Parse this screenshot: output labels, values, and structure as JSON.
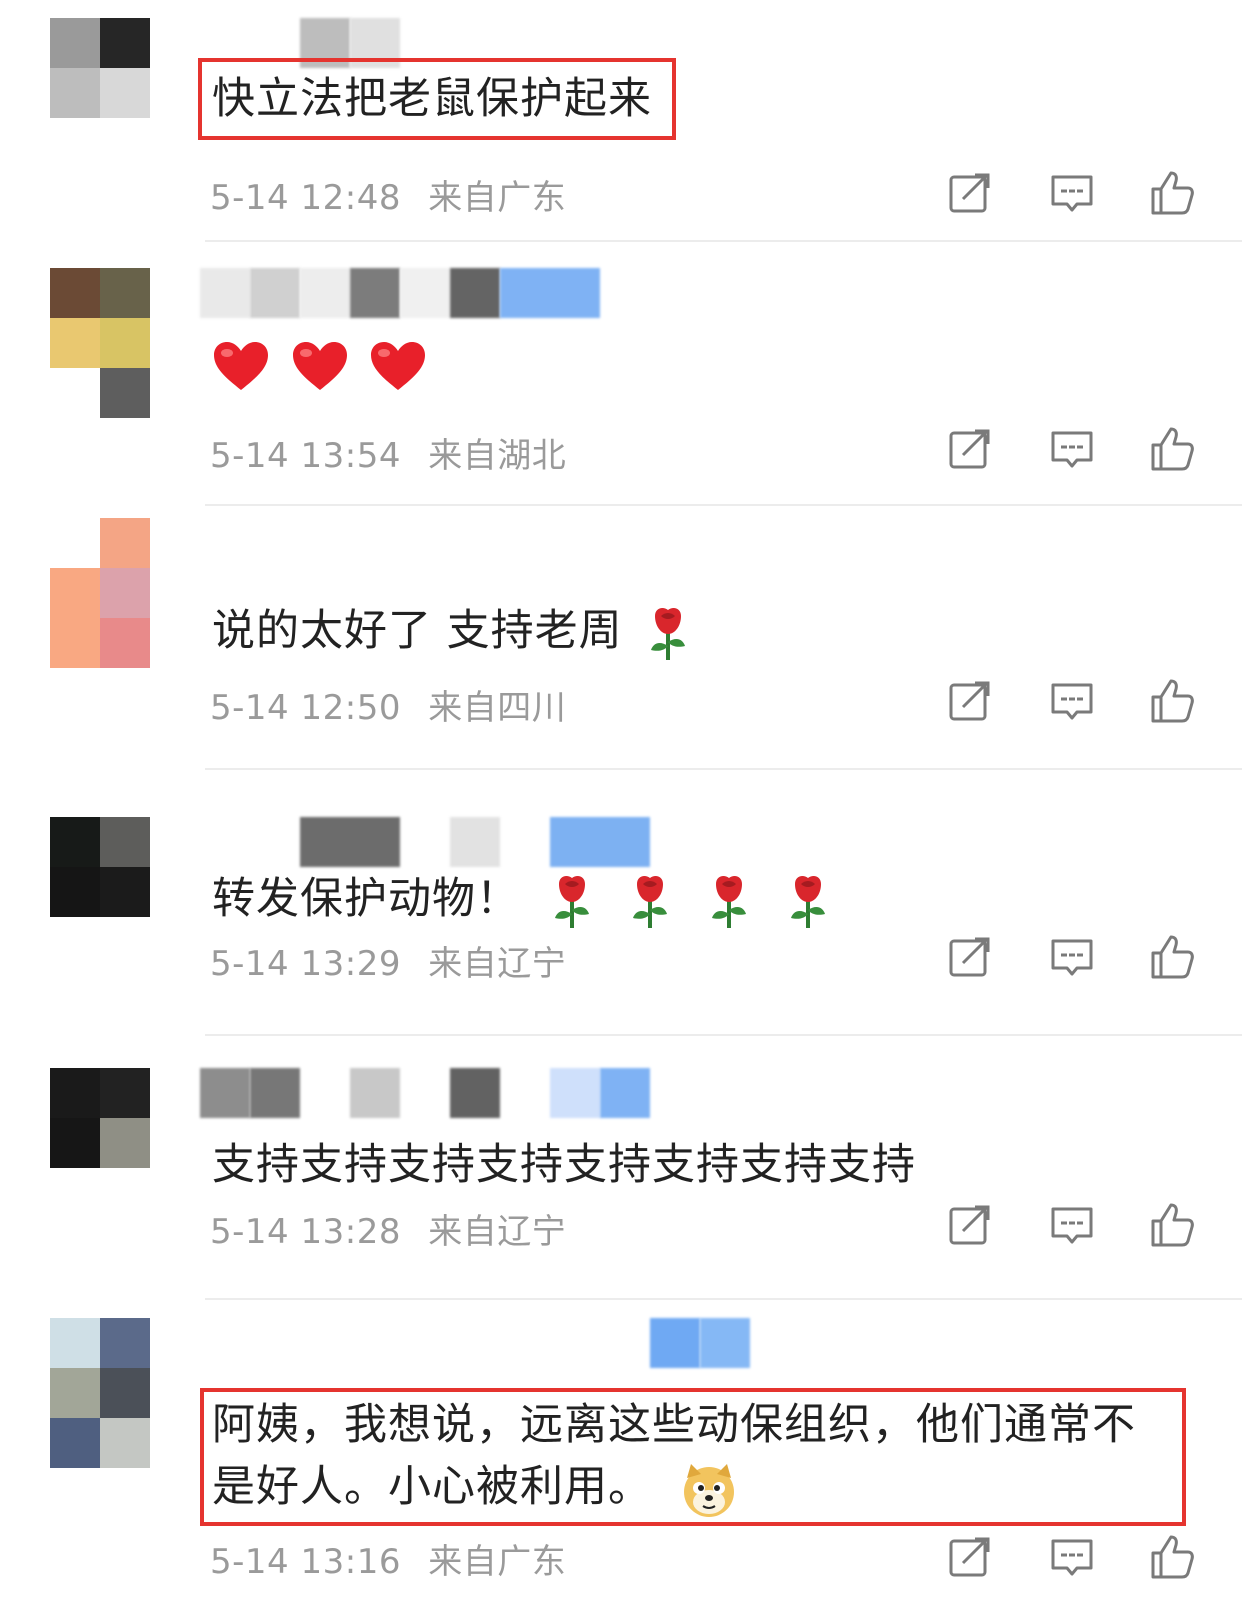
{
  "comments": [
    {
      "text": "快立法把老鼠保护起来",
      "time": "5-14 12:48",
      "location": "来自广东",
      "highlighted": true
    },
    {
      "text": "",
      "emoji": [
        "heart-icon",
        "heart-icon",
        "heart-icon"
      ],
      "time": "5-14 13:54",
      "location": "来自湖北",
      "highlighted": false
    },
    {
      "text": "说的太好了 支持老周",
      "emoji": [
        "rose-icon"
      ],
      "time": "5-14 12:50",
      "location": "来自四川",
      "highlighted": false
    },
    {
      "text": "转发保护动物！",
      "emoji": [
        "rose-icon",
        "rose-icon",
        "rose-icon",
        "rose-icon"
      ],
      "time": "5-14 13:29",
      "location": "来自辽宁",
      "highlighted": false
    },
    {
      "text": "支持支持支持支持支持支持支持支持",
      "time": "5-14 13:28",
      "location": "来自辽宁",
      "highlighted": false
    },
    {
      "text": "阿姨，我想说，远离这些动保组织，他们通常不是好人。小心被利用。",
      "emoji": [
        "doge-icon"
      ],
      "time": "5-14 13:16",
      "location": "来自广东",
      "highlighted": true
    }
  ],
  "icons": {
    "share": "share-icon",
    "reply": "comment-icon",
    "like": "thumbs-up-icon"
  },
  "colors": {
    "highlight_border": "#e5342f",
    "meta_text": "#9a9a9a",
    "divider": "#ececec",
    "heart": "#e8202a",
    "rose": "#d9262c"
  }
}
